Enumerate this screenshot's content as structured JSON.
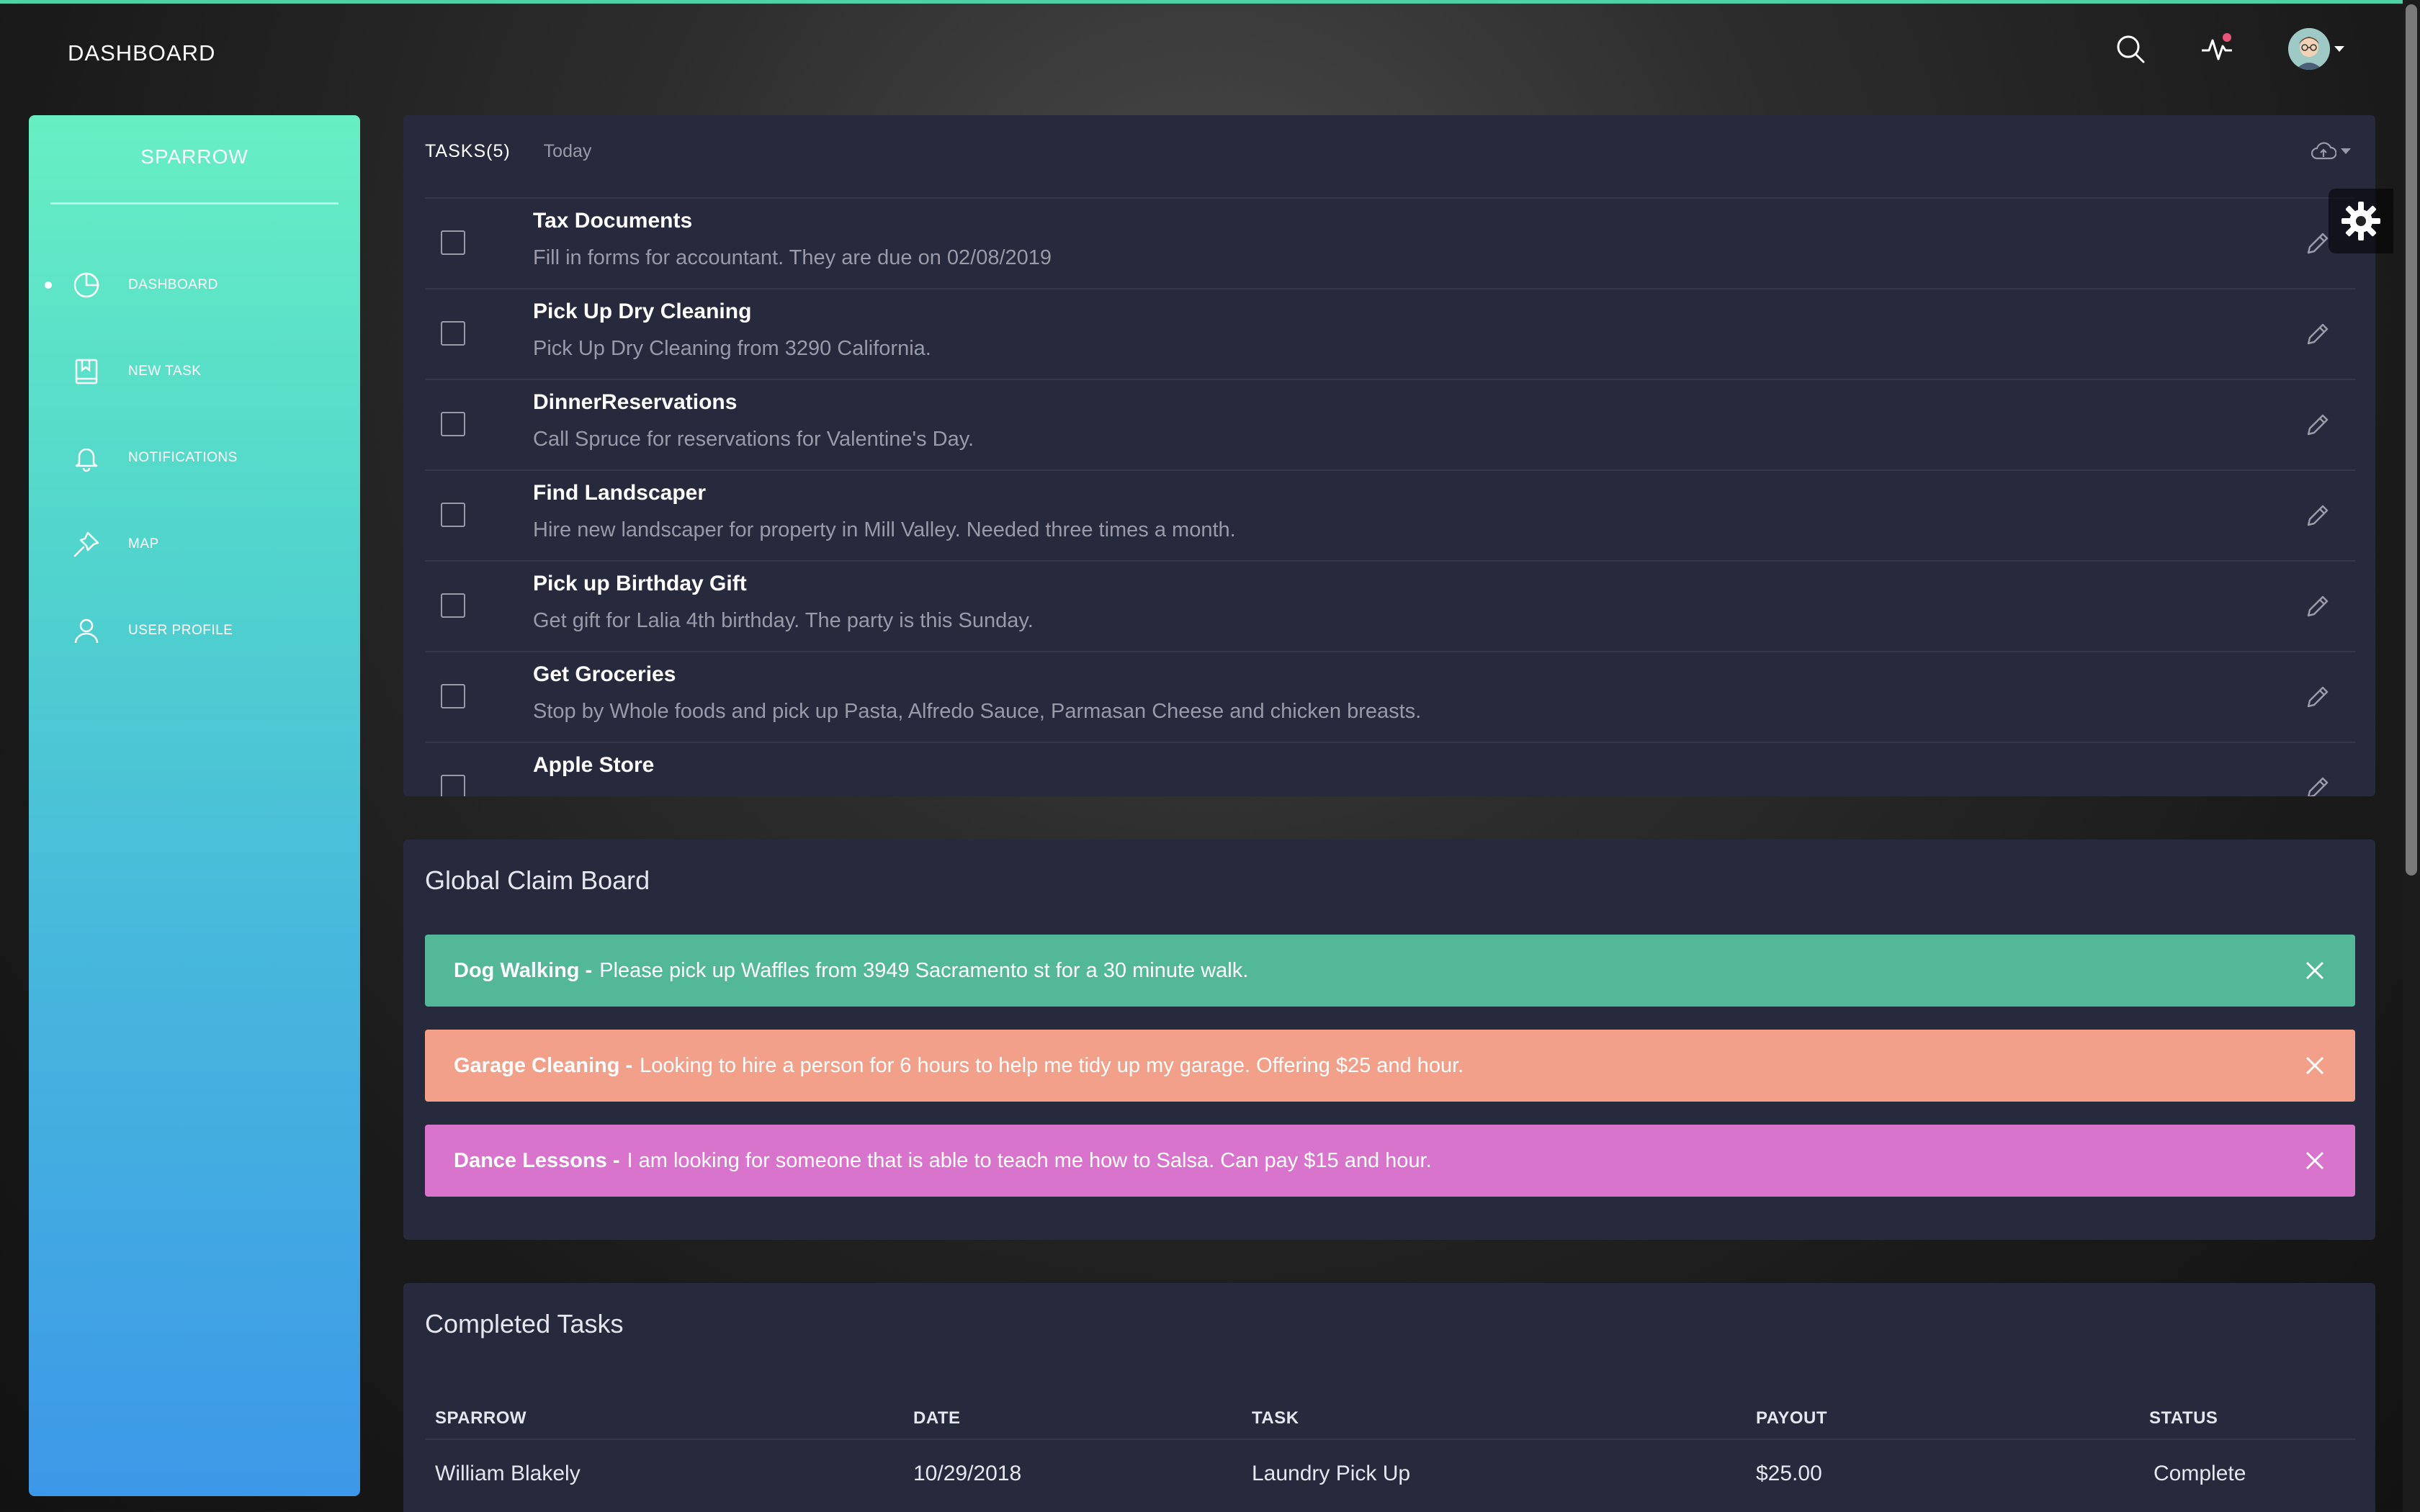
{
  "header": {
    "title": "DASHBOARD",
    "icons": [
      "search-icon",
      "activity-icon",
      "avatar"
    ]
  },
  "sidebar": {
    "brand": "SPARROW",
    "items": [
      {
        "label": "DASHBOARD",
        "icon": "pie-chart-icon",
        "active": true
      },
      {
        "label": "NEW TASK",
        "icon": "bookmark-book-icon",
        "active": false
      },
      {
        "label": "NOTIFICATIONS",
        "icon": "bell-icon",
        "active": false
      },
      {
        "label": "MAP",
        "icon": "pin-icon",
        "active": false
      },
      {
        "label": "USER PROFILE",
        "icon": "user-icon",
        "active": false
      }
    ]
  },
  "tasks": {
    "heading": "TASKS(5)",
    "subheading": "Today",
    "items": [
      {
        "title": "Tax Documents",
        "desc": "Fill in forms for accountant. They are due on 02/08/2019"
      },
      {
        "title": "Pick Up Dry Cleaning",
        "desc": "Pick Up Dry Cleaning from 3290 California."
      },
      {
        "title": "DinnerReservations",
        "desc": "Call Spruce for reservations for Valentine's Day."
      },
      {
        "title": "Find Landscaper",
        "desc": "Hire new landscaper for property in Mill Valley. Needed three times a month."
      },
      {
        "title": "Pick up Birthday Gift",
        "desc": "Get gift for Lalia 4th birthday. The party is this Sunday."
      },
      {
        "title": "Get Groceries",
        "desc": "Stop by Whole foods and pick up Pasta, Alfredo Sauce, Parmasan Cheese and chicken breasts."
      },
      {
        "title": "Apple Store",
        "desc": ""
      }
    ]
  },
  "claim_board": {
    "title": "Global Claim Board",
    "alerts": [
      {
        "label": "Dog Walking -",
        "text": "Please pick up Waffles from 3949 Sacramento st for a 30 minute walk.",
        "color": "#52b898"
      },
      {
        "label": "Garage Cleaning -",
        "text": "Looking to hire a person for 6 hours to help me tidy up my garage. Offering $25 and hour.",
        "color": "#f2a08a"
      },
      {
        "label": "Dance Lessons -",
        "text": "I am looking for someone that is able to teach me how to Salsa. Can pay $15 and hour.",
        "color": "#d874cc"
      }
    ]
  },
  "completed": {
    "title": "Completed Tasks",
    "columns": [
      "SPARROW",
      "DATE",
      "TASK",
      "PAYOUT",
      "STATUS"
    ],
    "rows": [
      [
        "William Blakely",
        "10/29/2018",
        "Laundry Pick Up",
        "$25.00",
        "Complete"
      ]
    ]
  },
  "colors": {
    "accent": "#4fd1a5",
    "card": "#27293d",
    "muted_text": "#9a9aa8"
  }
}
